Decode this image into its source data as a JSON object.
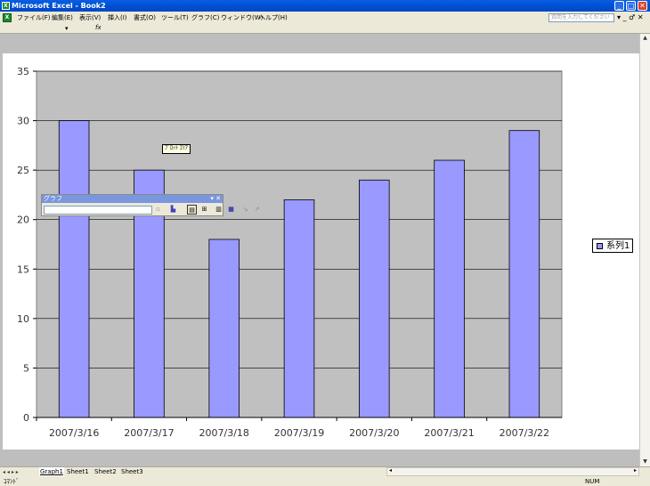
{
  "window": {
    "title": "Microsoft Excel - Book2",
    "app_icon": "X",
    "buttons": {
      "minimize": "_",
      "maximize": "□",
      "close": "✕"
    }
  },
  "menu": {
    "items": [
      "ファイル(F)",
      "編集(E)",
      "表示(V)",
      "挿入(I)",
      "書式(O)",
      "ツール(T)",
      "グラフ(C)",
      "ウィンドウ(W)",
      "ヘルプ(H)"
    ],
    "ask_placeholder": "質問を入力してください",
    "window_controls": "▾ _ ♂ ✕"
  },
  "formula": {
    "name_box_arrow": "▾",
    "fx": "fx"
  },
  "chart_toolbar": {
    "title": "グラフ",
    "controls": "▾ ✕"
  },
  "tooltip": "ﾌﾟﾛｯﾄ ｴﾘｱ",
  "sheet_tabs": {
    "nav": "◂ ◂ ▸ ▸",
    "tabs": [
      "Graph1",
      "Sheet1",
      "Sheet2",
      "Sheet3"
    ]
  },
  "status": {
    "left": "ｺﾏﾝﾄﾞ",
    "right": "NUM"
  },
  "colors": {
    "bar_fill": "#9999ff",
    "plot_bg": "#c0c0c0",
    "title_bar": "#0053d8"
  },
  "chart_data": {
    "type": "bar",
    "categories": [
      "2007/3/16",
      "2007/3/17",
      "2007/3/18",
      "2007/3/19",
      "2007/3/20",
      "2007/3/21",
      "2007/3/22"
    ],
    "series": [
      {
        "name": "系列1",
        "values": [
          30,
          25,
          18,
          22,
          24,
          26,
          29
        ]
      }
    ],
    "ylim": [
      0,
      35
    ],
    "yticks": [
      0,
      5,
      10,
      15,
      20,
      25,
      30,
      35
    ],
    "grid": true,
    "legend": "right"
  }
}
